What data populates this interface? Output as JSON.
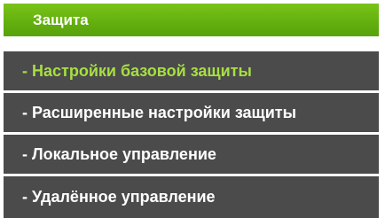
{
  "menu": {
    "header": "Защита",
    "items": [
      {
        "label": "- Настройки базовой защиты",
        "active": true
      },
      {
        "label": "- Расширенные настройки защиты",
        "active": false
      },
      {
        "label": "- Локальное управление",
        "active": false
      },
      {
        "label": "- Удалённое управление",
        "active": false
      }
    ],
    "colors": {
      "header_bg": "#64b00f",
      "item_bg": "#4b4b4b",
      "active_text": "#a7df42",
      "item_text": "#ffffff"
    }
  }
}
